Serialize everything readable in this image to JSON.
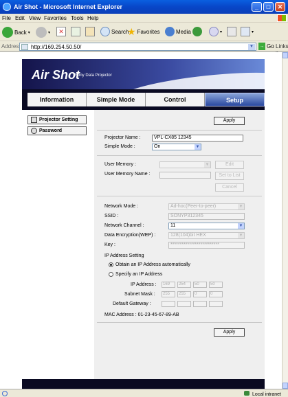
{
  "window": {
    "title": "Air Shot - Microsoft Internet Explorer"
  },
  "menu": [
    "File",
    "Edit",
    "View",
    "Favorites",
    "Tools",
    "Help"
  ],
  "toolbar": {
    "back": "Back",
    "search": "Search",
    "favorites": "Favorites",
    "media": "Media"
  },
  "address": {
    "label": "Address",
    "url": "http://169.254.50.50/",
    "go": "Go",
    "links": "Links"
  },
  "brand": {
    "logo": "Air Shot",
    "subtitle": "Sony Data Projector"
  },
  "nav": {
    "tabs": [
      "Information",
      "Simple Mode",
      "Control",
      "Setup"
    ],
    "active": "Setup"
  },
  "sidebar": {
    "projector_setting": "Projector Setting",
    "password": "Password"
  },
  "form": {
    "apply": "Apply",
    "projector_name_label": "Projector Name :",
    "projector_name_value": "VPL-CX85 12345",
    "simple_mode_label": "Simple Mode :",
    "simple_mode_value": "On",
    "user_memory_label": "User Memory :",
    "user_memory_name_label": "User Memory Name :",
    "edit": "Edit",
    "set_to_list": "Set to List",
    "cancel": "Cancel",
    "network_mode_label": "Network Mode :",
    "network_mode_value": "Ad-hoc(Peer-to-peer)",
    "ssid_label": "SSID :",
    "ssid_value": "SONYP312345",
    "network_channel_label": "Network Channel :",
    "network_channel_value": "11",
    "data_encryption_label": "Data Encryption(WEP) :",
    "data_encryption_value": "128(104)bit HEX",
    "key_label": "Key :",
    "key_value": "**************************",
    "ip_setting_label": "IP Address Setting",
    "obtain_auto": "Obtain an IP Address automatically",
    "specify_ip": "Specify an IP Address",
    "ip_address_label": "IP Address :",
    "ip_address": [
      "169",
      "254",
      "50",
      "50"
    ],
    "subnet_mask_label": "Subnet Mask :",
    "subnet_mask": [
      "255",
      "255",
      "0",
      "0"
    ],
    "default_gateway_label": "Default Gateway :",
    "default_gateway": [
      "",
      "",
      "",
      ""
    ],
    "mac_label": "MAC Address : 01-23-45-67-89-AB"
  },
  "status": {
    "zone": "Local intranet"
  }
}
